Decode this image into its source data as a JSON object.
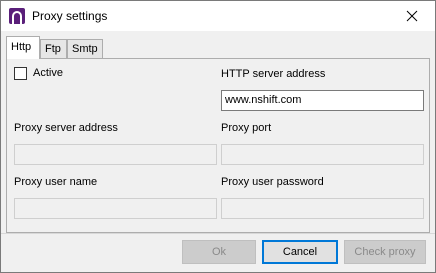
{
  "window": {
    "title": "Proxy settings"
  },
  "tabs": [
    {
      "label": "Http",
      "active": true
    },
    {
      "label": "Ftp",
      "active": false
    },
    {
      "label": "Smtp",
      "active": false
    }
  ],
  "form": {
    "active_label": "Active",
    "active_checked": false,
    "http_server_address_label": "HTTP server address",
    "http_server_address_value": "www.nshift.com",
    "proxy_server_address_label": "Proxy server address",
    "proxy_server_address_value": "",
    "proxy_port_label": "Proxy port",
    "proxy_port_value": "",
    "proxy_user_name_label": "Proxy user name",
    "proxy_user_name_value": "",
    "proxy_user_password_label": "Proxy user password",
    "proxy_user_password_value": ""
  },
  "buttons": {
    "ok_label": "Ok",
    "cancel_label": "Cancel",
    "check_proxy_label": "Check proxy"
  },
  "icons": {
    "app": "app-logo-icon",
    "close": "close-icon"
  },
  "colors": {
    "app_icon": "#5a1f7a",
    "default_button_border": "#0078d7"
  }
}
